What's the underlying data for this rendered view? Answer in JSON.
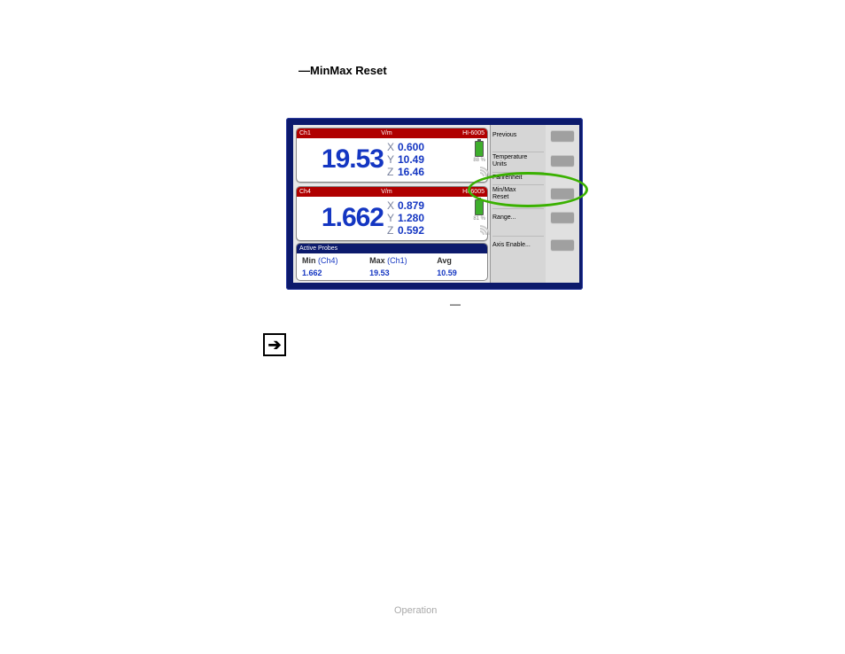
{
  "title_prefix": "—",
  "title": "MinMax Reset",
  "device": {
    "ch1": {
      "label": "Ch1",
      "unit": "V/m",
      "model": "HI-6005",
      "magnitude": "19.53",
      "x": "0.600",
      "y": "10.49",
      "z": "16.46",
      "batt": "88 %"
    },
    "ch4": {
      "label": "Ch4",
      "unit": "V/m",
      "model": "HI-6005",
      "magnitude": "1.662",
      "x": "0.879",
      "y": "1.280",
      "z": "0.592",
      "batt": "81 %"
    },
    "active": {
      "header": "Active Probes",
      "min_label": "Min",
      "min_ch": "(Ch4)",
      "max_label": "Max",
      "max_ch": "(Ch1)",
      "avg_label": "Avg",
      "min_val": "1.662",
      "max_val": "19.53",
      "avg_val": "10.59"
    },
    "softkeys": {
      "previous": "Previous",
      "temp_units": "Temperature\nUnits",
      "fahrenheit": "Fahrenheit",
      "minmax_reset_l1": "Min/Max",
      "minmax_reset_l2": "Reset",
      "range": "Range...",
      "axis_enable": "Axis Enable..."
    }
  },
  "caption_dash": "—",
  "footer": "Operation"
}
